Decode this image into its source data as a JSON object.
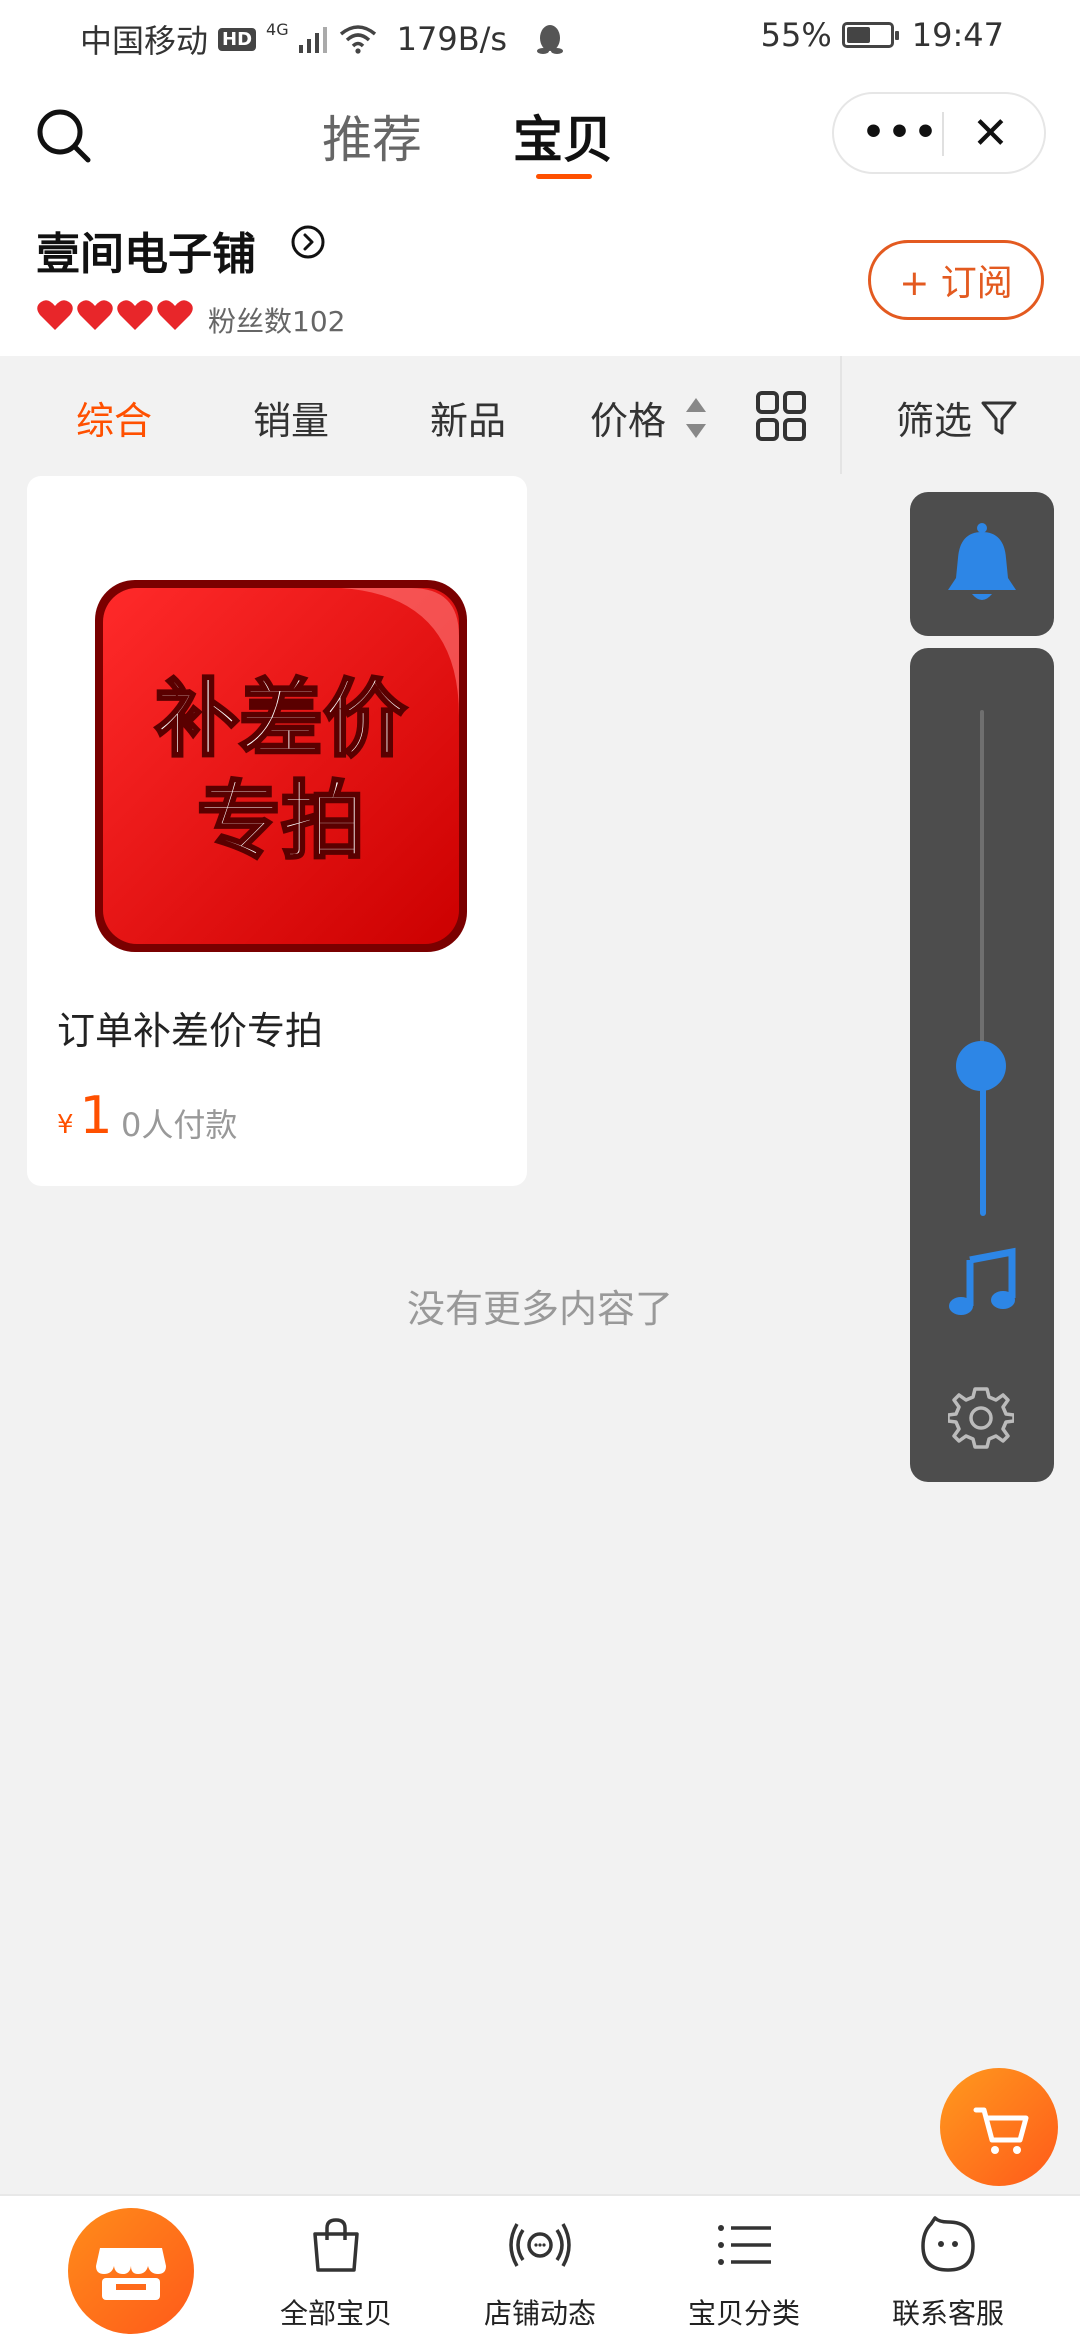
{
  "status_bar": {
    "carrier": "中国移动",
    "hd": "HD",
    "network": "4G",
    "speed": "179B/s",
    "battery": "55%",
    "battery_level": 0.55,
    "time": "19:47"
  },
  "header": {
    "tabs": [
      "推荐",
      "宝贝"
    ],
    "active_tab": "宝贝",
    "more_label": "•••",
    "close_label": "✕"
  },
  "shop": {
    "name": "壹间电子铺",
    "fans": "粉丝数102",
    "hearts": 4,
    "subscribe_label": "+ 订阅"
  },
  "sort": {
    "items": [
      "综合",
      "销量",
      "新品",
      "价格"
    ],
    "active": "综合",
    "filter_label": "筛选"
  },
  "product": {
    "image_text": [
      "补差价",
      "专拍"
    ],
    "title": "订单补差价专拍",
    "currency": "¥",
    "price": "1",
    "sold": "0人付款"
  },
  "list_end": "没有更多内容了",
  "floating_panel": {
    "slider_level": 0.28
  },
  "bottom_nav": {
    "items": [
      "全部宝贝",
      "店铺动态",
      "宝贝分类",
      "联系客服"
    ]
  },
  "colors": {
    "accent": "#ff5000",
    "subscribe": "#e35a20",
    "panel": "#4d4d4d",
    "blue": "#2d86e6"
  }
}
